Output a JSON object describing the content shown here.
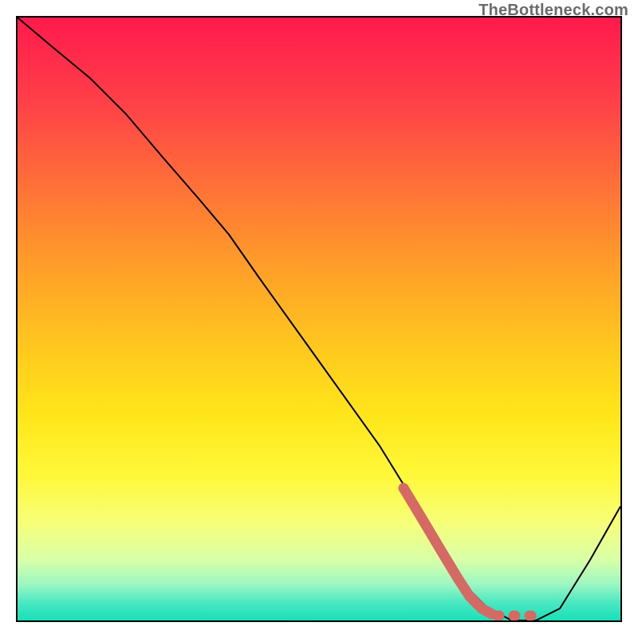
{
  "watermark": "TheBottleneck.com",
  "chart_data": {
    "type": "line",
    "title": "",
    "xlabel": "",
    "ylabel": "",
    "xlim": [
      0,
      100
    ],
    "ylim": [
      0,
      100
    ],
    "grid": false,
    "series": [
      {
        "name": "main-curve",
        "color": "#000000",
        "stroke_width": 2,
        "x": [
          0,
          6,
          12,
          18,
          24,
          30,
          35,
          40,
          45,
          50,
          55,
          60,
          65,
          70,
          74,
          78,
          82,
          86,
          90,
          95,
          100
        ],
        "y": [
          100,
          95,
          90,
          84,
          77,
          70,
          64,
          57,
          50,
          43,
          36,
          29,
          21,
          13,
          6,
          2,
          0,
          0,
          2,
          10,
          19
        ]
      },
      {
        "name": "highlight-segment",
        "color": "#d46a63",
        "stroke_width": 10,
        "dashed_tail": true,
        "x": [
          64,
          67,
          70,
          73,
          75,
          77,
          79,
          81,
          83,
          85
        ],
        "y": [
          22,
          17,
          12,
          7,
          4,
          2,
          1,
          1,
          1,
          1
        ]
      }
    ],
    "background_gradient": {
      "top": "#ff1a4d",
      "mid": "#ffe61a",
      "bottom": "#18e0b8"
    }
  }
}
